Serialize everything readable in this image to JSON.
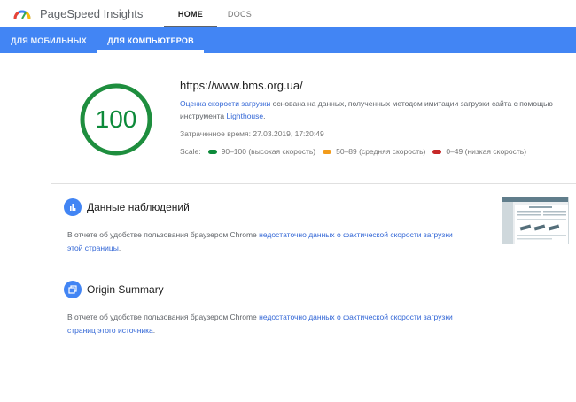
{
  "header": {
    "brand": "PageSpeed Insights",
    "nav": [
      {
        "label": "HOME"
      },
      {
        "label": "DOCS"
      }
    ]
  },
  "device_tabs": [
    {
      "label": "ДЛЯ МОБИЛЬНЫХ"
    },
    {
      "label": "ДЛЯ КОМПЬЮТЕРОВ",
      "selected": true
    }
  ],
  "result": {
    "score": "100",
    "url": "https://www.bms.org.ua/",
    "desc_link": "Оценка скорости загрузки",
    "desc_text": " основана на данных, полученных методом имитации загрузки сайта с помощью инструмента ",
    "desc_link2": "Lighthouse",
    "desc_end": ".",
    "time": "Затраченное время: 27.03.2019, 17:20:49",
    "scale_label": "Scale:",
    "scale": [
      {
        "label": "90–100 (высокая скорость)",
        "color": "#0d8a3a"
      },
      {
        "label": "50–89 (средняя скорость)",
        "color": "#f29b1b"
      },
      {
        "label": "0–49 (низкая скорость)",
        "color": "#c62828"
      }
    ]
  },
  "sections": [
    {
      "title": "Данные наблюдений",
      "icon": "bar-chart-icon",
      "text": "В отчете об удобстве пользования браузером Chrome ",
      "link": "недостаточно данных о фактической скорости загрузки этой страницы",
      "end": "."
    },
    {
      "title": "Origin Summary",
      "icon": "layers-icon",
      "text": "В отчете об удобстве пользования браузером Chrome ",
      "link": "недостаточно данных о фактической скорости загрузки страниц этого источника",
      "end": "."
    }
  ],
  "colors": {
    "accent": "#4285f4",
    "good": "#0d8a3a",
    "link": "#3367d6"
  }
}
